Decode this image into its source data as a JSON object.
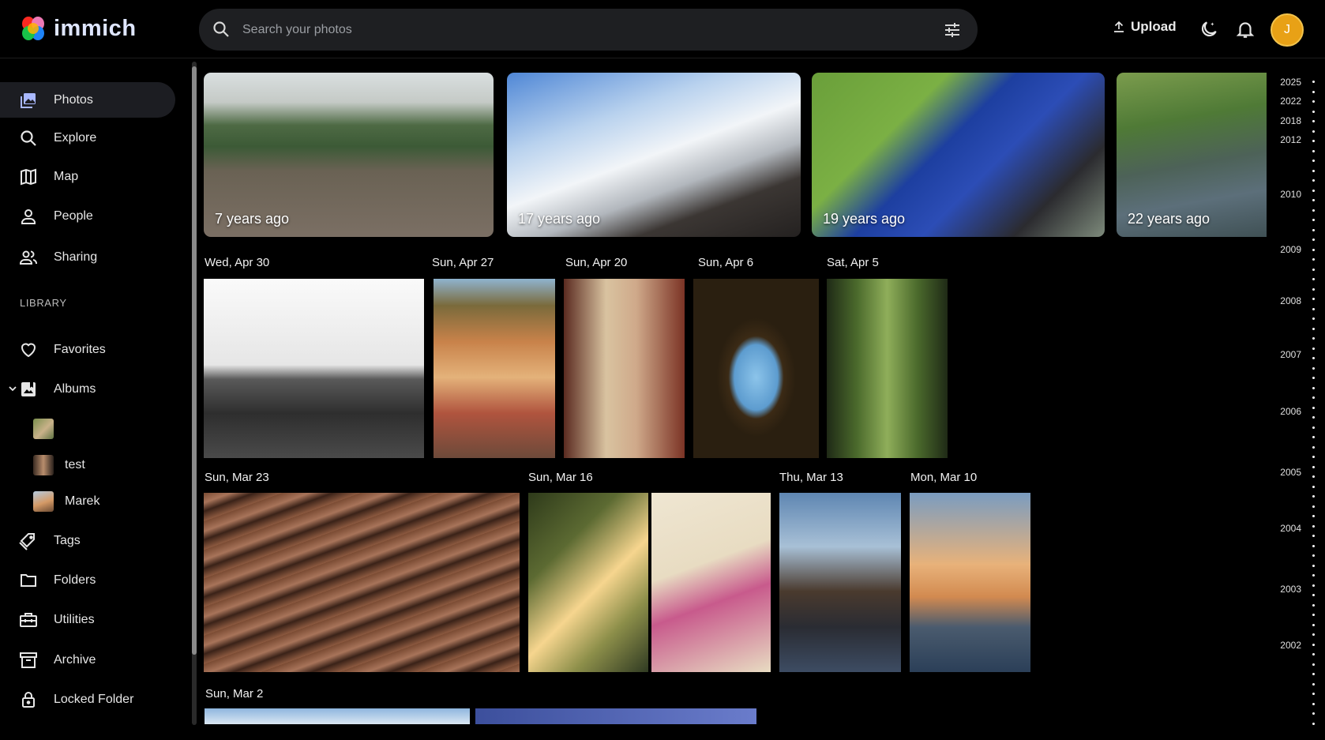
{
  "header": {
    "app_name": "immich",
    "search_placeholder": "Search your photos",
    "upload_label": "Upload",
    "avatar_initial": "J"
  },
  "sidebar": {
    "nav": [
      {
        "label": "Photos",
        "icon": "photos-icon"
      },
      {
        "label": "Explore",
        "icon": "search-icon"
      },
      {
        "label": "Map",
        "icon": "map-icon"
      },
      {
        "label": "People",
        "icon": "person-icon"
      },
      {
        "label": "Sharing",
        "icon": "people-icon"
      }
    ],
    "library_label": "LIBRARY",
    "library": [
      {
        "label": "Favorites",
        "icon": "heart-icon"
      },
      {
        "label": "Albums",
        "icon": "album-icon"
      }
    ],
    "albums": [
      {
        "label": ""
      },
      {
        "label": "test"
      },
      {
        "label": "Marek"
      }
    ],
    "more": [
      {
        "label": "Tags",
        "icon": "tag-icon"
      },
      {
        "label": "Folders",
        "icon": "folder-icon"
      },
      {
        "label": "Utilities",
        "icon": "toolbox-icon"
      },
      {
        "label": "Archive",
        "icon": "archive-icon"
      },
      {
        "label": "Locked Folder",
        "icon": "lock-icon"
      }
    ]
  },
  "memories": [
    {
      "label": "7 years ago"
    },
    {
      "label": "17 years ago"
    },
    {
      "label": "19 years ago"
    },
    {
      "label": "22 years ago"
    }
  ],
  "groups": [
    {
      "date": "Wed, Apr 30"
    },
    {
      "date": "Sun, Apr 27"
    },
    {
      "date": "Sun, Apr 20"
    },
    {
      "date": "Sun, Apr 6"
    },
    {
      "date": "Sat, Apr 5"
    },
    {
      "date": "Sun, Mar 23"
    },
    {
      "date": "Sun, Mar 16"
    },
    {
      "date": "Thu, Mar 13"
    },
    {
      "date": "Mon, Mar 10"
    },
    {
      "date": "Sun, Mar 2"
    }
  ],
  "timeline_years": [
    "2025",
    "2022",
    "2018",
    "2012",
    "2010",
    "2009",
    "2008",
    "2007",
    "2006",
    "2005",
    "2004",
    "2003",
    "2002"
  ]
}
